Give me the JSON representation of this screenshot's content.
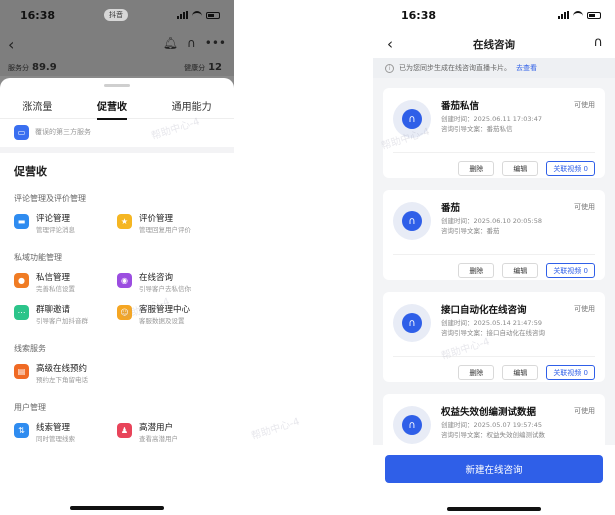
{
  "left": {
    "status": {
      "time": "16:38",
      "app": "抖音"
    },
    "scores": {
      "service_label": "服务分",
      "service_value": "89.9",
      "health_label": "健康分",
      "health_value": "12"
    },
    "tabs": [
      "涨流量",
      "促营收",
      "通用能力"
    ],
    "active_tab": 1,
    "prev_card_text": "覆误的第三方服务",
    "section_title": "促营收",
    "groups": [
      {
        "title": "评论管理及评价管理",
        "items": [
          {
            "title": "评论管理",
            "sub": "管理评论消息",
            "icon": "comment-icon",
            "color": "#2f8cf0",
            "glyph": "▬"
          },
          {
            "title": "评价管理",
            "sub": "管理回复用户评价",
            "icon": "star-icon",
            "color": "#f5b622",
            "glyph": "★"
          }
        ]
      },
      {
        "title": "私域功能管理",
        "items": [
          {
            "title": "私信管理",
            "sub": "完善私信设置",
            "icon": "user-icon",
            "color": "#f07c24",
            "glyph": "●"
          },
          {
            "title": "在线咨询",
            "sub": "引导客户去私信你",
            "icon": "chat-icon",
            "color": "#9b4de0",
            "glyph": "◉"
          },
          {
            "title": "群聊邀请",
            "sub": "引导客户加抖音群",
            "icon": "group-chat-icon",
            "color": "#2cc48a",
            "glyph": "⋯"
          },
          {
            "title": "客服管理中心",
            "sub": "客服数据及设置",
            "icon": "customer-service-icon",
            "color": "#f5a623",
            "glyph": "☺"
          }
        ]
      },
      {
        "title": "线索服务",
        "items": [
          {
            "title": "高级在线预约",
            "sub": "预约左下角留电话",
            "icon": "calendar-icon",
            "color": "#f06a24",
            "glyph": "▤"
          }
        ]
      },
      {
        "title": "用户管理",
        "items": [
          {
            "title": "线索管理",
            "sub": "同时管理线索",
            "icon": "clue-icon",
            "color": "#2f8cf0",
            "glyph": "⇅"
          },
          {
            "title": "高潜用户",
            "sub": "查看高潜用户",
            "icon": "high-potential-user-icon",
            "color": "#e8445a",
            "glyph": "♟"
          }
        ]
      }
    ]
  },
  "right": {
    "status": {
      "time": "16:38"
    },
    "title": "在线咨询",
    "notice": {
      "text": "已为您同步生成在线咨询直播卡片。",
      "link": "去查看"
    },
    "cards": [
      {
        "title": "番茄私信",
        "created": "创建时间：2025.06.11 17:03:47",
        "guide": "咨询引导文案：番茄私信",
        "status": "可使用"
      },
      {
        "title": "番茄",
        "created": "创建时间：2025.06.10 20:05:58",
        "guide": "咨询引导文案：番茄",
        "status": "可使用"
      },
      {
        "title": "接口自动化在线咨询",
        "created": "创建时间：2025.05.14 21:47:59",
        "guide": "咨询引导文案：接口自动化在线咨询",
        "status": "可使用"
      },
      {
        "title": "权益失效创编测试数据",
        "created": "创建时间：2025.05.07 19:57:45",
        "guide": "咨询引导文案：权益失效创编测试数",
        "status": "可使用"
      }
    ],
    "actions": {
      "delete": "删除",
      "edit": "编辑",
      "link_video": "关联视频 0"
    },
    "primary_button": "新建在线咨询",
    "accent_color": "#2f5fe8"
  },
  "watermark": "帮助中心-4"
}
